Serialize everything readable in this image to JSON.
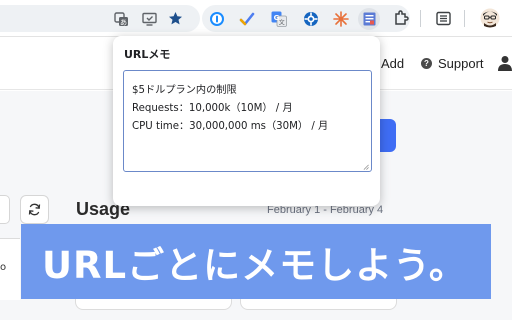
{
  "popup": {
    "title": "URLメモ",
    "memo_value": "$5ドルプラン内の制限\nRequests：10,000k（10M） / 月\nCPU time：30,000,000 ms（30M） / 月"
  },
  "page": {
    "nav": {
      "add": "Add",
      "support": "Support"
    },
    "usage_title": "Usage",
    "date_range": "February 1 - February 4",
    "left_fragment": "o"
  },
  "banner": {
    "text": "URLごとにメモしよう。"
  },
  "icons": {
    "translate": "translate-icon",
    "cast": "cast-icon",
    "bookmark": "star-icon",
    "onepassword": "1password-icon",
    "check_ext": "checkmark-extension-icon",
    "google_translate": "google-translate-icon",
    "gear_ext": "blue-gear-extension-icon",
    "burst_ext": "orange-burst-extension-icon",
    "memo_ext": "memo-extension-icon",
    "puzzle": "extensions-puzzle-icon",
    "reading_list": "reading-list-icon",
    "avatar": "profile-avatar-icon"
  },
  "colors": {
    "banner": "#6f99ed",
    "primary_button": "#3f6df4",
    "memo_border": "#6b89c9",
    "star": "#1e4f8c"
  }
}
